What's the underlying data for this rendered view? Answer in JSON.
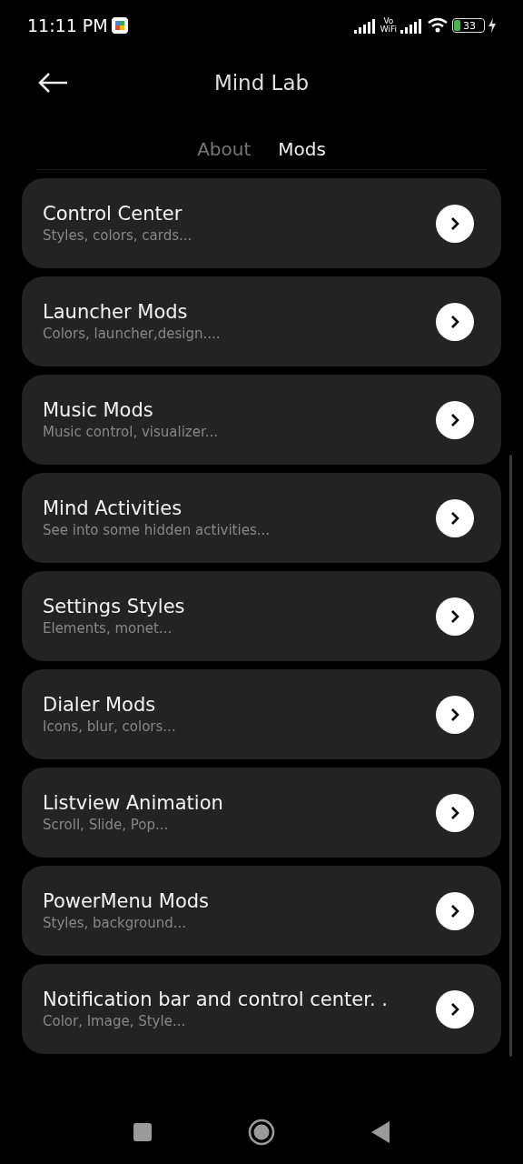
{
  "status_bar": {
    "time": "11:11 PM",
    "vowifi_top": "Vo",
    "vowifi_bottom": "WiFi",
    "battery": "33"
  },
  "title": "Mind Lab",
  "tabs": [
    {
      "label": "About",
      "selected": false
    },
    {
      "label": "Mods",
      "selected": true
    }
  ],
  "items": [
    {
      "title": "Control Center",
      "subtitle": "Styles, colors, cards..."
    },
    {
      "title": "Launcher Mods",
      "subtitle": "Colors, launcher,design...."
    },
    {
      "title": "Music Mods",
      "subtitle": "Music control, visualizer..."
    },
    {
      "title": "Mind Activities",
      "subtitle": "See into some hidden activities..."
    },
    {
      "title": "Settings Styles",
      "subtitle": "Elements, monet..."
    },
    {
      "title": "Dialer Mods",
      "subtitle": "Icons, blur, colors..."
    },
    {
      "title": "Listview Animation",
      "subtitle": "Scroll, Slide, Pop..."
    },
    {
      "title": "PowerMenu Mods",
      "subtitle": "Styles, background..."
    },
    {
      "title": "Notification bar and control center. .",
      "subtitle": "Color, Image, Style..."
    }
  ]
}
